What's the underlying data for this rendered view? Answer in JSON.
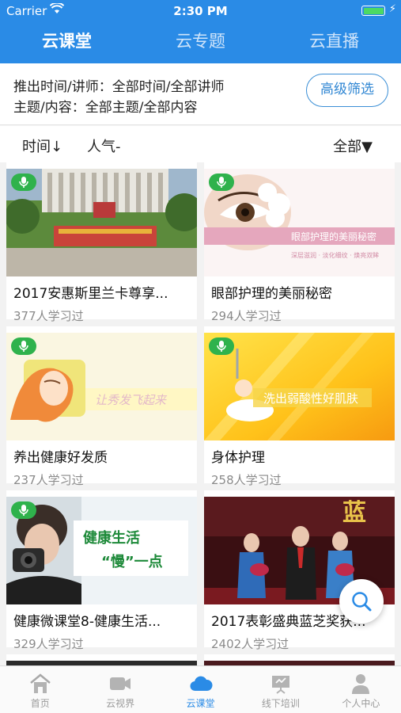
{
  "status": {
    "carrier": "Carrier",
    "time": "2:30 PM"
  },
  "tabs": [
    "云课堂",
    "云专题",
    "云直播"
  ],
  "filter": {
    "line1": "推出时间/讲师：全部时间/全部讲师",
    "line2": "主题/内容：全部主题/全部内容",
    "advanced_button": "高级筛选"
  },
  "sort": {
    "time": "时间↓",
    "popularity": "人气-",
    "category": "全部▼"
  },
  "courses": [
    {
      "title": "2017安惠斯里兰卡尊享...",
      "count": "377人学习过"
    },
    {
      "title": "眼部护理的美丽秘密",
      "count": "294人学习过",
      "thumb_text": "眼部护理的美丽秘密",
      "thumb_sub": "深层滋润 · 淡化细纹 · 焕亮双眸"
    },
    {
      "title": "养出健康好发质",
      "count": "237人学习过",
      "thumb_text": "让秀发飞起来"
    },
    {
      "title": "身体护理",
      "count": "258人学习过",
      "thumb_text": "洗出弱酸性好肌肤"
    },
    {
      "title": "健康微课堂8-健康生活...",
      "count": "329人学习过",
      "thumb_text1": "健康生活",
      "thumb_text2": "“慢”一点"
    },
    {
      "title": "2017表彰盛典蓝芝奖获...",
      "count": "2402人学习过",
      "thumb_text": "蓝"
    }
  ],
  "bottom_nav": [
    "首页",
    "云视界",
    "云课堂",
    "线下培训",
    "个人中心"
  ],
  "colors": {
    "brand": "#2a8be6",
    "badge": "#2fb24c"
  }
}
